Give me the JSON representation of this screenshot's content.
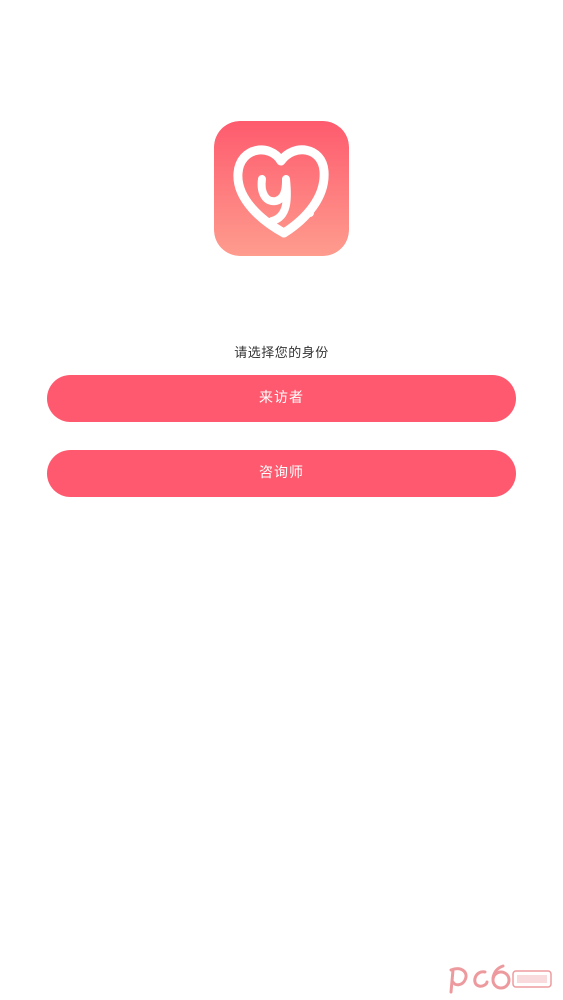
{
  "app": {
    "logo_icon": "heart-letter-y-logo",
    "brand_gradient": [
      "#fe5b6e",
      "#fe9a8c"
    ]
  },
  "prompt": {
    "text": "请选择您的身份"
  },
  "roles": [
    {
      "label": "来访者"
    },
    {
      "label": "咨询师"
    }
  ],
  "colors": {
    "button": "#fe596e",
    "button_text": "#ffffff",
    "prompt_text": "#333333"
  },
  "watermark": {
    "icon": "pc6-watermark-icon"
  }
}
